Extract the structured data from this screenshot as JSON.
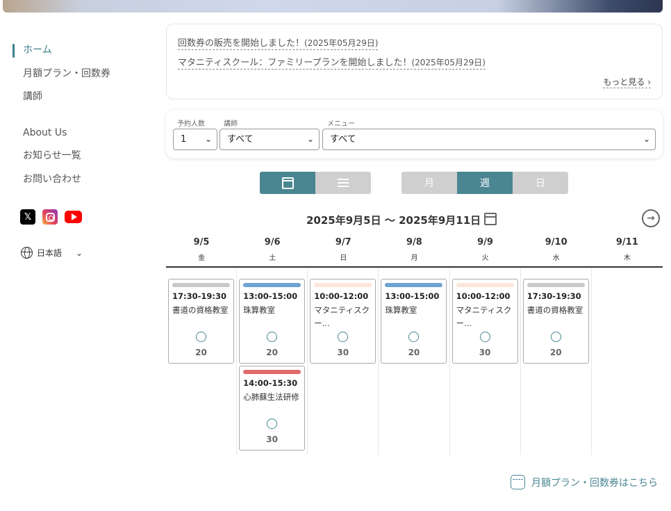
{
  "sidebar": {
    "items": [
      {
        "label": "ホーム"
      },
      {
        "label": "月額プラン・回数券"
      },
      {
        "label": "講師"
      },
      {
        "label": "About Us"
      },
      {
        "label": "お知らせ一覧"
      },
      {
        "label": "お問い合わせ"
      }
    ],
    "language": "日本語"
  },
  "news": {
    "items": [
      {
        "text": "回数券の販売を開始しました！",
        "date": "(2025年05月29日)"
      },
      {
        "text": "マタニティスクール：ファミリープランを開始しました！",
        "date": "(2025年05月29日)"
      }
    ],
    "more_label": "もっと見る"
  },
  "filters": {
    "people_label": "予約人数",
    "people_value": "1",
    "instructor_label": "講師",
    "instructor_value": "すべて",
    "menu_label": "メニュー",
    "menu_value": "すべて"
  },
  "view_toggle": {
    "active": "calendar"
  },
  "range_toggle": {
    "month": "月",
    "week": "週",
    "day": "日",
    "active": "week"
  },
  "week_title": "2025年9月5日 〜 2025年9月11日",
  "days": [
    {
      "date": "9/5",
      "weekday": "金"
    },
    {
      "date": "9/6",
      "weekday": "土"
    },
    {
      "date": "9/7",
      "weekday": "日"
    },
    {
      "date": "9/8",
      "weekday": "月"
    },
    {
      "date": "9/9",
      "weekday": "火"
    },
    {
      "date": "9/10",
      "weekday": "水"
    },
    {
      "date": "9/11",
      "weekday": "木"
    }
  ],
  "events": [
    {
      "day": 0,
      "row": 0,
      "time": "17:30-19:30",
      "title": "書道の資格教室",
      "capacity": "20",
      "color": "#c9c9c9"
    },
    {
      "day": 1,
      "row": 0,
      "time": "13:00-15:00",
      "title": "珠算教室",
      "capacity": "20",
      "color": "#6fa3d4"
    },
    {
      "day": 1,
      "row": 1,
      "time": "14:00-15:30",
      "title": "心肺蘇生法研修",
      "capacity": "30",
      "color": "#e06a6a"
    },
    {
      "day": 2,
      "row": 0,
      "time": "10:00-12:00",
      "title": "マタニティスクー...",
      "capacity": "30",
      "color": "#fde6d9"
    },
    {
      "day": 3,
      "row": 0,
      "time": "13:00-15:00",
      "title": "珠算教室",
      "capacity": "20",
      "color": "#6fa3d4"
    },
    {
      "day": 4,
      "row": 0,
      "time": "10:00-12:00",
      "title": "マタニティスクー...",
      "capacity": "30",
      "color": "#fde6d9"
    },
    {
      "day": 5,
      "row": 0,
      "time": "17:30-19:30",
      "title": "書道の資格教室",
      "capacity": "20",
      "color": "#c9c9c9"
    }
  ],
  "footer_link": "月額プラン・回数券はこちら",
  "colors": {
    "accent": "#4a8592"
  }
}
